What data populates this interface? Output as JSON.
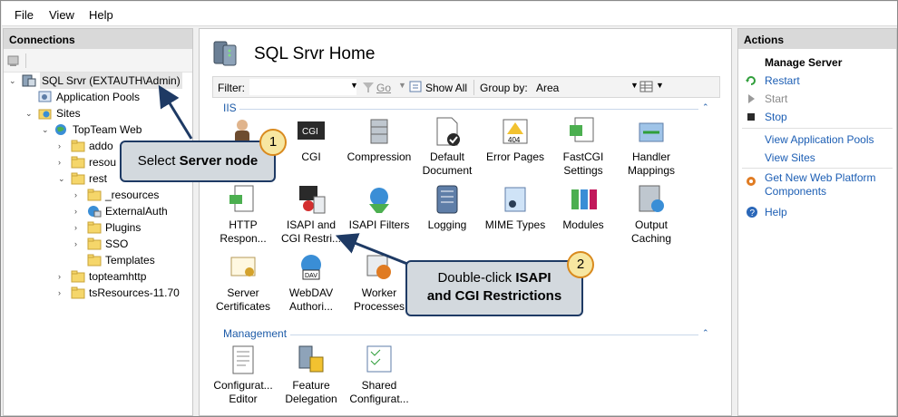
{
  "menu": [
    "File",
    "View",
    "Help"
  ],
  "connections": {
    "header": "Connections",
    "tree": [
      {
        "label": "SQL Srvr (EXTAUTH\\Admin)",
        "depth": 0,
        "exp": "⌄",
        "icon": "server"
      },
      {
        "label": "Application Pools",
        "depth": 1,
        "exp": "",
        "icon": "apppool"
      },
      {
        "label": "Sites",
        "depth": 1,
        "exp": "⌄",
        "icon": "sites"
      },
      {
        "label": "TopTeam Web",
        "depth": 2,
        "exp": "⌄",
        "icon": "globe"
      },
      {
        "label": "addo",
        "depth": 3,
        "exp": "›",
        "icon": "folder"
      },
      {
        "label": "resou",
        "depth": 3,
        "exp": "›",
        "icon": "folder"
      },
      {
        "label": "rest",
        "depth": 3,
        "exp": "⌄",
        "icon": "folder"
      },
      {
        "label": "_resources",
        "depth": 4,
        "exp": "›",
        "icon": "folder"
      },
      {
        "label": "ExternalAuth",
        "depth": 4,
        "exp": "›",
        "icon": "app"
      },
      {
        "label": "Plugins",
        "depth": 4,
        "exp": "›",
        "icon": "folder"
      },
      {
        "label": "SSO",
        "depth": 4,
        "exp": "›",
        "icon": "folder"
      },
      {
        "label": "Templates",
        "depth": 4,
        "exp": "",
        "icon": "folder"
      },
      {
        "label": "topteamhttp",
        "depth": 3,
        "exp": "›",
        "icon": "folder"
      },
      {
        "label": "tsResources-11.70",
        "depth": 3,
        "exp": "›",
        "icon": "folder"
      }
    ]
  },
  "center": {
    "title": "SQL Srvr Home",
    "filter_label": "Filter:",
    "go_label": "Go",
    "show_all_label": "Show All",
    "group_by_label": "Group by:",
    "group_by_value": "Area",
    "section_iis": "IIS",
    "section_management": "Management",
    "features": [
      {
        "l1": "",
        "l2": "",
        "icon": "person-key"
      },
      {
        "l1": "CGI",
        "l2": "",
        "icon": "cgi"
      },
      {
        "l1": "Compression",
        "l2": "",
        "icon": "compress"
      },
      {
        "l1": "Default",
        "l2": "Document",
        "icon": "doc-check"
      },
      {
        "l1": "Error Pages",
        "l2": "",
        "icon": "error-404"
      },
      {
        "l1": "FastCGI",
        "l2": "Settings",
        "icon": "fastcgi"
      },
      {
        "l1": "Handler",
        "l2": "Mappings",
        "icon": "handler"
      },
      {
        "l1": "HTTP",
        "l2": "Respon...",
        "icon": "http-response"
      },
      {
        "l1": "ISAPI and",
        "l2": "CGI Restri...",
        "icon": "isapi-cgi"
      },
      {
        "l1": "ISAPI Filters",
        "l2": "",
        "icon": "isapi-filter"
      },
      {
        "l1": "Logging",
        "l2": "",
        "icon": "logging"
      },
      {
        "l1": "MIME Types",
        "l2": "",
        "icon": "mime"
      },
      {
        "l1": "Modules",
        "l2": "",
        "icon": "modules"
      },
      {
        "l1": "Output",
        "l2": "Caching",
        "icon": "output-cache"
      },
      {
        "l1": "Server",
        "l2": "Certificates",
        "icon": "certificates"
      },
      {
        "l1": "WebDAV",
        "l2": "Authori...",
        "icon": "webdav"
      },
      {
        "l1": "Worker",
        "l2": "Processes",
        "icon": "worker"
      }
    ],
    "management": [
      {
        "l1": "Configurat...",
        "l2": "Editor",
        "icon": "config-editor"
      },
      {
        "l1": "Feature",
        "l2": "Delegation",
        "icon": "feature-delegation"
      },
      {
        "l1": "Shared",
        "l2": "Configurat...",
        "icon": "shared-config"
      }
    ]
  },
  "actions": {
    "header": "Actions",
    "group_title": "Manage Server",
    "restart": "Restart",
    "start": "Start",
    "stop": "Stop",
    "view_app_pools": "View Application Pools",
    "view_sites": "View Sites",
    "get_platform_1": "Get New Web Platform",
    "get_platform_2": "Components",
    "help": "Help"
  },
  "callouts": {
    "c1_prefix": "Select ",
    "c1_bold": "Server node",
    "c1_num": "1",
    "c2_prefix": "Double-click ",
    "c2_bold1": "ISAPI",
    "c2_bold2": "and CGI Restrictions",
    "c2_num": "2"
  },
  "colors": {
    "link": "#1c5eb4",
    "callout_border": "#1e3a64",
    "badge": "#f7e7a1"
  }
}
